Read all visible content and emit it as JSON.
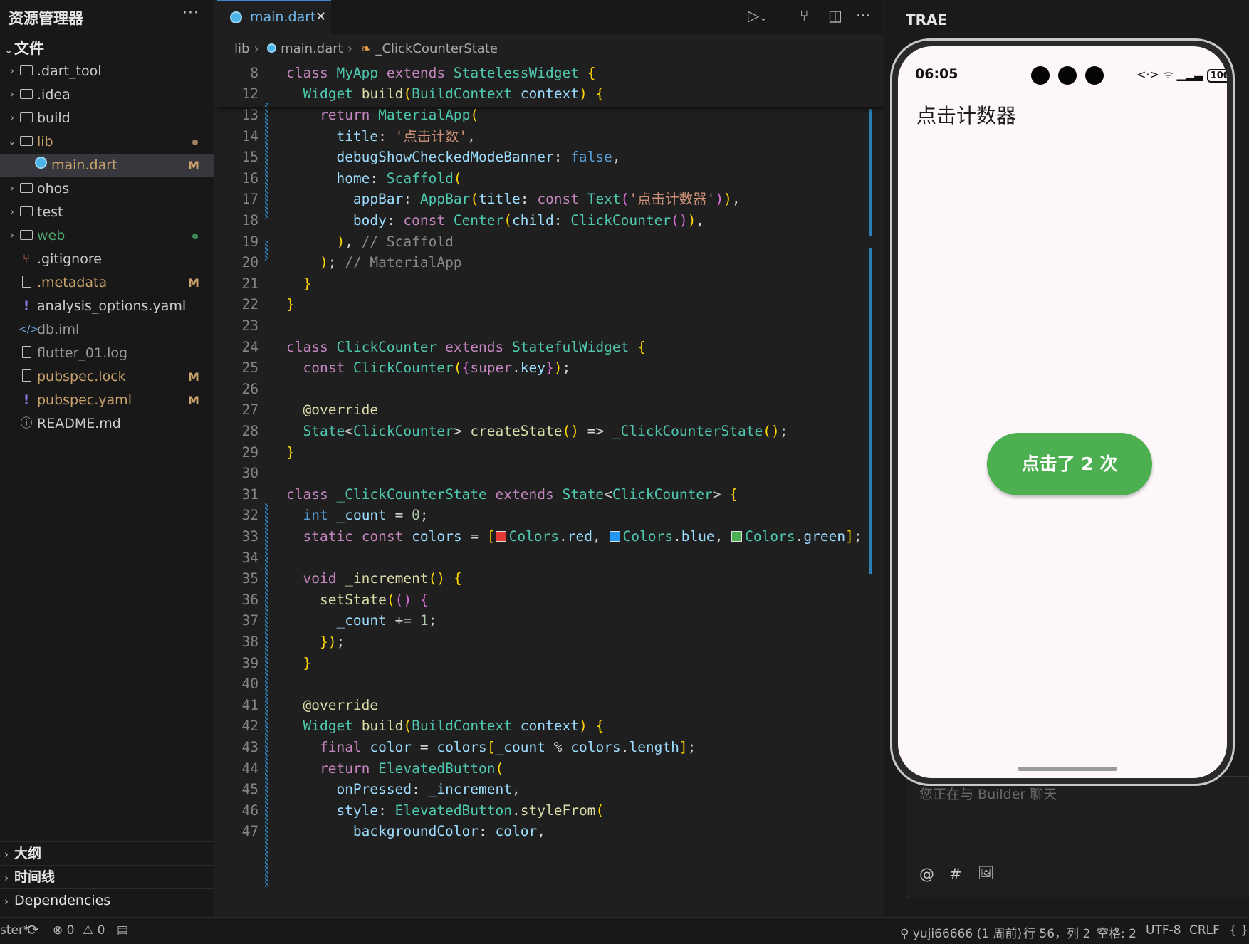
{
  "explorer": {
    "title": "资源管理器",
    "more": "···",
    "section": "文件",
    "items": [
      {
        "name": "dart-tool",
        "label": ".dart_tool",
        "type": "folder",
        "badge": "",
        "color": "#cccccc"
      },
      {
        "name": "idea",
        "label": ".idea",
        "type": "folder",
        "badge": "",
        "color": "#cccccc"
      },
      {
        "name": "build",
        "label": "build",
        "type": "folder",
        "badge": "",
        "color": "#cccccc"
      },
      {
        "name": "lib",
        "label": "lib",
        "type": "folder-open",
        "badge": "",
        "color": "#c9a36b"
      },
      {
        "name": "main-dart",
        "label": "main.dart",
        "type": "dart",
        "badge": "M",
        "color": "#c9a36b"
      },
      {
        "name": "ohos",
        "label": "ohos",
        "type": "folder",
        "badge": "",
        "color": "#cccccc"
      },
      {
        "name": "test",
        "label": "test",
        "type": "folder",
        "badge": "",
        "color": "#cccccc"
      },
      {
        "name": "web",
        "label": "web",
        "type": "folder",
        "badge": "",
        "color": "#4ea86b"
      },
      {
        "name": "gitignore",
        "label": ".gitignore",
        "type": "git",
        "badge": "",
        "color": "#cccccc"
      },
      {
        "name": "metadata",
        "label": ".metadata",
        "type": "file",
        "badge": "M",
        "color": "#c9a36b"
      },
      {
        "name": "analysis-options",
        "label": "analysis_options.yaml",
        "type": "yaml",
        "badge": "",
        "color": "#cccccc"
      },
      {
        "name": "db-iml",
        "label": "db.iml",
        "type": "xml",
        "badge": "",
        "color": "#9a9a9a"
      },
      {
        "name": "flutter-log",
        "label": "flutter_01.log",
        "type": "file",
        "badge": "",
        "color": "#9a9a9a"
      },
      {
        "name": "pubspec-lock",
        "label": "pubspec.lock",
        "type": "file",
        "badge": "M",
        "color": "#c9a36b"
      },
      {
        "name": "pubspec-yaml",
        "label": "pubspec.yaml",
        "type": "yaml",
        "badge": "M",
        "color": "#c9a36b"
      },
      {
        "name": "readme",
        "label": "README.md",
        "type": "info",
        "badge": "",
        "color": "#cccccc"
      }
    ],
    "bottom_sections": [
      "大纲",
      "时间线",
      "Dependencies"
    ]
  },
  "editor": {
    "tab_label": "main.dart",
    "tab_close": "✕",
    "breadcrumb": {
      "folder": "lib",
      "file": "main.dart",
      "symbol": "_ClickCounterState"
    }
  },
  "right_panel": {
    "title": "TRAE",
    "chat_placeholder": "您正在与 Builder 聊天",
    "tools": [
      "@",
      "#",
      "🖼"
    ]
  },
  "phone": {
    "time": "06:05",
    "status_icons": "<·>  ᯤ  ▁▂▃",
    "battery": "100",
    "app_title": "点击计数器",
    "button_label": "点击了 2 次",
    "button_color": "#4caf50",
    "background": "#fdf7fb"
  },
  "statusbar": {
    "branch": "ster*",
    "errors": "0",
    "warnings": "0",
    "blame": "yuji66666 (1 周前)",
    "position": "行 56，列 2",
    "spaces": "空格: 2",
    "encoding": "UTF-8",
    "eol": "CRLF",
    "lang": "{ }"
  },
  "code": {
    "line_numbers": [
      "8",
      "12",
      "13",
      "14",
      "15",
      "16",
      "17",
      "18",
      "19",
      "20",
      "21",
      "22",
      "23",
      "24",
      "25",
      "26",
      "27",
      "28",
      "29",
      "30",
      "31",
      "32",
      "33",
      "34",
      "35",
      "36",
      "37",
      "38",
      "39",
      "40",
      "41",
      "42",
      "43",
      "44",
      "45",
      "46",
      "47"
    ],
    "lines": [
      "class MyApp extends StatelessWidget {",
      "  Widget build(BuildContext context) {",
      "    return MaterialApp(",
      "      title: '点击计数',",
      "      debugShowCheckedModeBanner: false,",
      "      home: Scaffold(",
      "        appBar: AppBar(title: const Text('点击计数器')),",
      "        body: const Center(child: ClickCounter()),",
      "      ), // Scaffold",
      "    ); // MaterialApp",
      "  }",
      "}",
      "",
      "class ClickCounter extends StatefulWidget {",
      "  const ClickCounter({super.key});",
      "",
      "  @override",
      "  State<ClickCounter> createState() => _ClickCounterState();",
      "}",
      "",
      "class _ClickCounterState extends State<ClickCounter> {",
      "  int _count = 0;",
      "  static const colors = [Colors.red, Colors.blue, Colors.green];",
      "",
      "  void _increment() {",
      "    setState(() {",
      "      _count += 1;",
      "    });",
      "  }",
      "",
      "  @override",
      "  Widget build(BuildContext context) {",
      "    final color = colors[_count % colors.length];",
      "    return ElevatedButton(",
      "      onPressed: _increment,",
      "      style: ElevatedButton.styleFrom(",
      "        backgroundColor: color,"
    ]
  }
}
